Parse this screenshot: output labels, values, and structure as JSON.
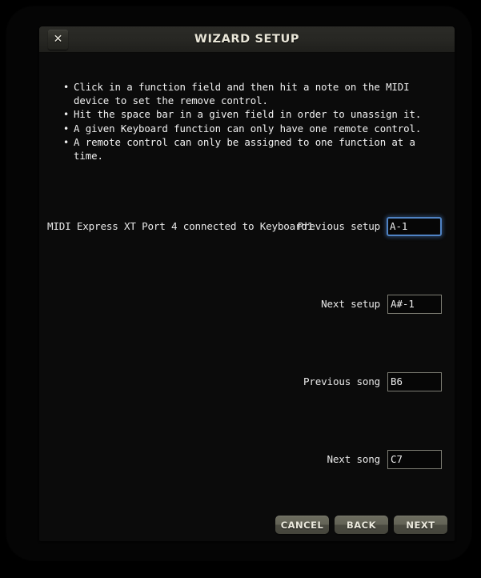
{
  "window": {
    "title": "WIZARD SETUP",
    "close_icon": "close-icon",
    "close_glyph": "✕"
  },
  "instructions": [
    "Click in a function field and then hit a note on the MIDI device to set the remove control.",
    "Hit the space bar in a given field in order to unassign it.",
    "A given Keyboard function can only have one remote control.",
    "A remote control can only be assigned to one function at a time."
  ],
  "device": {
    "connection_label": "MIDI Express XT Port 4 connected to Keyboard1"
  },
  "fields": [
    {
      "label": "Previous setup",
      "value": "A-1",
      "focused": true
    },
    {
      "label": "Next setup",
      "value": "A#-1",
      "focused": false
    },
    {
      "label": "Previous song",
      "value": "B6",
      "focused": false
    },
    {
      "label": "Next song",
      "value": "C7",
      "focused": false
    }
  ],
  "buttons": {
    "cancel": "CANCEL",
    "back": "BACK",
    "next": "NEXT"
  },
  "colors": {
    "focus_border": "#4f83c4",
    "field_border": "#7e7e74",
    "title_text": "#e9e6d8",
    "button_face": "#636356",
    "body_background": "#0b0b0b"
  }
}
